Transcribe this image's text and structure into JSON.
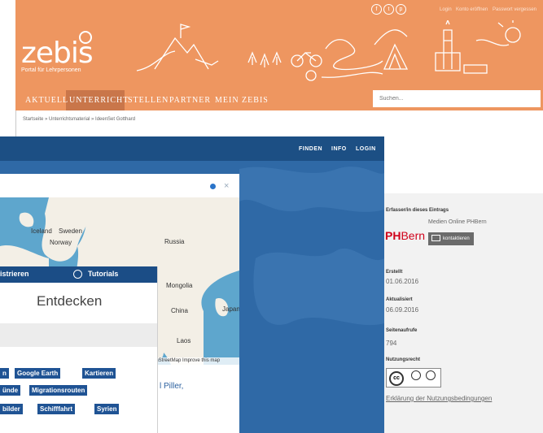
{
  "zebis": {
    "logo": "zebis",
    "tagline": "Portal für Lehrpersonen",
    "social_icons": [
      "facebook-icon",
      "twitter-icon",
      "pinterest-icon"
    ],
    "top_links": [
      "Login",
      "Konto eröffnen",
      "Passwort vergessen"
    ],
    "nav": [
      "AKTUELL",
      "UNTERRICHT",
      "STELLEN",
      "PARTNER",
      "MEIN ZEBIS"
    ],
    "search_placeholder": "Suchen...",
    "breadcrumb": "Startseite » Unterrichtsmaterial » IdeenSet Gotthard",
    "colors": {
      "header": "#ee9660",
      "active_nav": "#c9764a"
    }
  },
  "info": {
    "author_label": "Erfasser/in dieses Eintrags",
    "author_name": "Medien Online PHBern",
    "logo_ph": "PH",
    "logo_bern": "Bern",
    "contact_button": "kontaktieren",
    "created_label": "Erstellt",
    "created_value": "01.06.2016",
    "updated_label": "Aktualisiert",
    "updated_value": "06.09.2016",
    "views_label": "Seitenaufrufe",
    "views_value": "794",
    "license_label": "Nutzungsrecht",
    "license_icons": [
      "cc-icon",
      "by-icon",
      "sa-icon"
    ],
    "license_link": "Erklärung der Nutzungsbedingungen"
  },
  "mapapp": {
    "nav": [
      "FINDEN",
      "INFO",
      "LOGIN"
    ],
    "map_labels": [
      "Iceland",
      "Sweden",
      "Norway",
      "Russia",
      "Mongolia",
      "China",
      "Japan",
      "Laos"
    ],
    "attribution": "enStreetMap Improve this map",
    "author_fragment": "l Piller,",
    "colors": {
      "bar": "#1c4f84",
      "bg": "#2f69a6",
      "tag": "#1f5394"
    }
  },
  "dialog": {
    "register": "istrieren",
    "tutorials": "Tutorials",
    "title": "Entdecken",
    "tags": [
      [
        "n",
        "Google Earth",
        "Kartieren"
      ],
      [
        "ünde",
        "Migrationsrouten"
      ],
      [
        "bilder",
        "Schifffahrt",
        "Syrien"
      ]
    ]
  }
}
